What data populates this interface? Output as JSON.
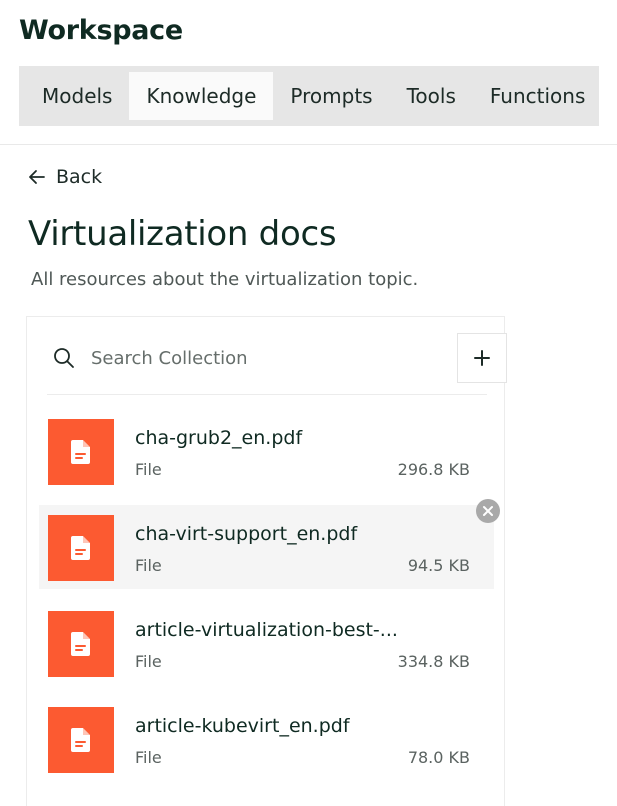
{
  "workspace": {
    "title": "Workspace",
    "tabs": [
      {
        "label": "Models",
        "active": false
      },
      {
        "label": "Knowledge",
        "active": true
      },
      {
        "label": "Prompts",
        "active": false
      },
      {
        "label": "Tools",
        "active": false
      },
      {
        "label": "Functions",
        "active": false
      }
    ]
  },
  "back_label": "Back",
  "knowledge": {
    "title": "Virtualization docs",
    "description": "All resources about the virtualization topic."
  },
  "search": {
    "placeholder": "Search Collection",
    "value": ""
  },
  "files": [
    {
      "name": "cha-grub2_en.pdf",
      "type": "File",
      "size": "296.8 KB"
    },
    {
      "name": "cha-virt-support_en.pdf",
      "type": "File",
      "size": "94.5 KB"
    },
    {
      "name": "article-virtualization-best-...",
      "type": "File",
      "size": "334.8 KB"
    },
    {
      "name": "article-kubevirt_en.pdf",
      "type": "File",
      "size": "78.0 KB"
    }
  ],
  "icons": {
    "back": "arrow-left-icon",
    "search": "search-icon",
    "add": "plus-icon",
    "file": "document-icon",
    "remove": "close-icon"
  },
  "colors": {
    "accent_file_icon": "#fc5a31",
    "tabbar_bg": "#e6e6e6",
    "active_tab_bg": "#fafafa",
    "title_text": "#0f2a22"
  }
}
